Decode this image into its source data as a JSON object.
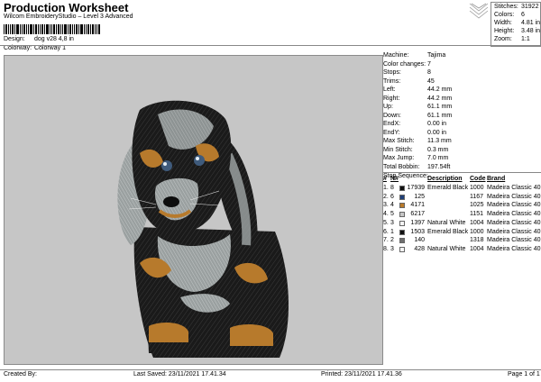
{
  "header": {
    "title": "Production Worksheet",
    "subtitle": "Wilcom EmbroideryStudio – Level 3 Advanced",
    "design_label": "Design:",
    "design_value": "dog v28 4,8 in",
    "colorway_label": "Colorway:",
    "colorway_value": "Colorway 1"
  },
  "stats": [
    {
      "label": "Stitches:",
      "value": "31922"
    },
    {
      "label": "Colors:",
      "value": "6"
    },
    {
      "label": "Width:",
      "value": "4.81 in"
    },
    {
      "label": "Height:",
      "value": "3.48 in"
    },
    {
      "label": "Zoom:",
      "value": "1:1"
    }
  ],
  "info": [
    {
      "label": "Machine:",
      "value": "Tajima"
    },
    {
      "label": "Color changes:",
      "value": "7"
    },
    {
      "label": "Stops:",
      "value": "8"
    },
    {
      "label": "Trims:",
      "value": "45"
    },
    {
      "label": "Left:",
      "value": "44.2 mm"
    },
    {
      "label": "Right:",
      "value": "44.2 mm"
    },
    {
      "label": "Up:",
      "value": "61.1 mm"
    },
    {
      "label": "Down:",
      "value": "61.1 mm"
    },
    {
      "label": "EndX:",
      "value": "0.00 in"
    },
    {
      "label": "EndY:",
      "value": "0.00 in"
    },
    {
      "label": "Max Stitch:",
      "value": "11.3 mm"
    },
    {
      "label": "Min Stitch:",
      "value": "0.3 mm"
    },
    {
      "label": "Max Jump:",
      "value": "7.0 mm"
    },
    {
      "label": "Total Bobbin:",
      "value": "197.54ft"
    }
  ],
  "stop_sequence": {
    "title": "Stop Sequence:",
    "headers": {
      "num": "#",
      "n": "N#",
      "description": "Description",
      "code": "Code",
      "brand": "Brand"
    },
    "rows": [
      {
        "num": "1.",
        "n": "8",
        "color": "#111111",
        "stitches": "17939",
        "description": "Emerald Black",
        "code": "1000",
        "brand": "Madeira Classic 40"
      },
      {
        "num": "2.",
        "n": "6",
        "color": "#1f3f78",
        "stitches": "125",
        "description": "",
        "code": "1167",
        "brand": "Madeira Classic 40"
      },
      {
        "num": "3.",
        "n": "4",
        "color": "#b97a2a",
        "stitches": "4171",
        "description": "",
        "code": "1025",
        "brand": "Madeira Classic 40"
      },
      {
        "num": "4.",
        "n": "5",
        "color": "#c7c7c7",
        "stitches": "6217",
        "description": "",
        "code": "1151",
        "brand": "Madeira Classic 40"
      },
      {
        "num": "5.",
        "n": "3",
        "color": "#f4f4f4",
        "stitches": "1397",
        "description": "Natural White",
        "code": "1004",
        "brand": "Madeira Classic 40"
      },
      {
        "num": "6.",
        "n": "1",
        "color": "#111111",
        "stitches": "1503",
        "description": "Emerald Black",
        "code": "1000",
        "brand": "Madeira Classic 40"
      },
      {
        "num": "7.",
        "n": "2",
        "color": "#6e6e6e",
        "stitches": "140",
        "description": "",
        "code": "1318",
        "brand": "Madeira Classic 40"
      },
      {
        "num": "8.",
        "n": "3",
        "color": "#f4f4f4",
        "stitches": "428",
        "description": "Natural White",
        "code": "1004",
        "brand": "Madeira Classic 40"
      }
    ]
  },
  "footer": {
    "created_by": "Created By:",
    "last_saved": "Last Saved: 23/11/2021 17.41.34",
    "printed": "Printed: 23/11/2021 17.41.36",
    "page": "Page 1 of 1"
  }
}
